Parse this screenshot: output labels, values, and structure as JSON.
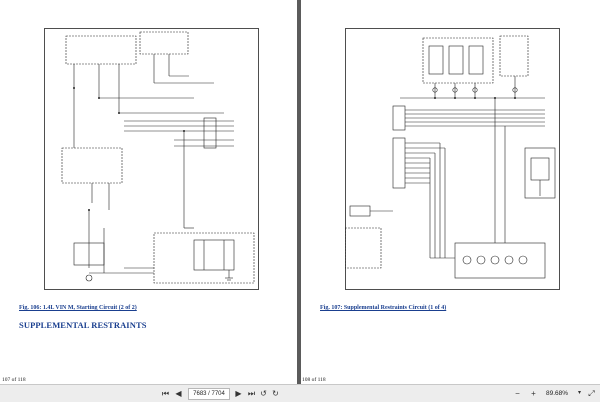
{
  "left_page": {
    "figure_caption": "Fig. 106: 1.4L VIN M, Starting Circuit (2 of 2)",
    "section_title": "SUPPLEMENTAL RESTRAINTS",
    "page_footer": "107 of 118"
  },
  "right_page": {
    "figure_caption": "Fig. 107: Supplemental Restraints Circuit (1 of 4)",
    "page_footer": "108 of 118"
  },
  "toolbar": {
    "first_page_icon": "first-page-icon",
    "prev_page_icon": "prev-page-icon",
    "page_indicator": "7683 / 7704",
    "next_page_icon": "next-page-icon",
    "last_page_icon": "last-page-icon",
    "rotate_ccw_icon": "rotate-ccw-icon",
    "rotate_cw_icon": "rotate-cw-icon",
    "zoom_out_icon": "zoom-out-icon",
    "zoom_in_icon": "zoom-in-icon",
    "zoom_level": "89.68%",
    "zoom_dropdown_icon": "chevron-down-icon",
    "fit_width_icon": "fit-width-icon"
  }
}
